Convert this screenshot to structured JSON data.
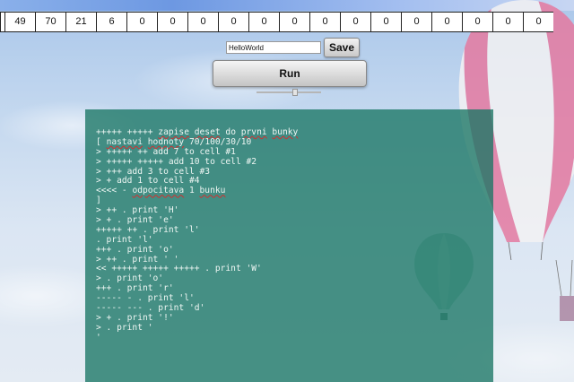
{
  "memory": {
    "cells": [
      "",
      "49",
      "70",
      "21",
      "6",
      "0",
      "0",
      "0",
      "0",
      "0",
      "0",
      "0",
      "0",
      "0",
      "0",
      "0",
      "0",
      "0",
      "0"
    ]
  },
  "controls": {
    "input_value": "HelloWorld",
    "save_label": "Save",
    "run_label": "Run"
  },
  "code": {
    "lines": [
      {
        "parts": [
          {
            "t": "+++++ +++++ "
          },
          {
            "t": "zapise",
            "u": true
          },
          {
            "t": " "
          },
          {
            "t": "deset",
            "u": true
          },
          {
            "t": " do "
          },
          {
            "t": "prvni",
            "u": true
          },
          {
            "t": " "
          },
          {
            "t": "bunky",
            "u": true
          }
        ]
      },
      {
        "parts": [
          {
            "t": "[ "
          },
          {
            "t": "nastavi",
            "u": true
          },
          {
            "t": " "
          },
          {
            "t": "hodnoty",
            "u": true
          },
          {
            "t": " 70/100/30/10"
          }
        ]
      },
      {
        "parts": [
          {
            "t": "> +++++ ++ add 7 to cell #1"
          }
        ]
      },
      {
        "parts": [
          {
            "t": "> +++++ +++++ add 10 to cell #2"
          }
        ]
      },
      {
        "parts": [
          {
            "t": "> +++ add 3 to cell #3"
          }
        ]
      },
      {
        "parts": [
          {
            "t": "> + add 1 to cell #4"
          }
        ]
      },
      {
        "parts": [
          {
            "t": "<<<< - "
          },
          {
            "t": "odpocitava",
            "u": true
          },
          {
            "t": " 1 "
          },
          {
            "t": "bunku",
            "u": true
          }
        ]
      },
      {
        "parts": [
          {
            "t": "]"
          }
        ]
      },
      {
        "parts": [
          {
            "t": "> ++ . print 'H'"
          }
        ]
      },
      {
        "parts": [
          {
            "t": "> + . print 'e'"
          }
        ]
      },
      {
        "parts": [
          {
            "t": "+++++ ++ . print 'l'"
          }
        ]
      },
      {
        "parts": [
          {
            "t": ". print 'l'"
          }
        ]
      },
      {
        "parts": [
          {
            "t": "+++ . print 'o'"
          }
        ]
      },
      {
        "parts": [
          {
            "t": "> ++ . print ' '"
          }
        ]
      },
      {
        "parts": [
          {
            "t": "<< +++++ +++++ +++++ . print 'W'"
          }
        ]
      },
      {
        "parts": [
          {
            "t": "> . print 'o'"
          }
        ]
      },
      {
        "parts": [
          {
            "t": "+++ . print 'r'"
          }
        ]
      },
      {
        "parts": [
          {
            "t": "----- - . print 'l'"
          }
        ]
      },
      {
        "parts": [
          {
            "t": "----- --- . print 'd'"
          }
        ]
      },
      {
        "parts": [
          {
            "t": "> + . print '!'"
          }
        ]
      },
      {
        "parts": [
          {
            "t": "> . print '"
          }
        ]
      },
      {
        "parts": [
          {
            "t": "'"
          }
        ]
      }
    ]
  },
  "colors": {
    "panel": "#1a7664",
    "squiggle": "#d23030"
  },
  "decor": {
    "background": "sky-with-clouds",
    "balloon_large": "hot-air-balloon-pink-white",
    "balloon_small": "hot-air-balloon-teal"
  }
}
